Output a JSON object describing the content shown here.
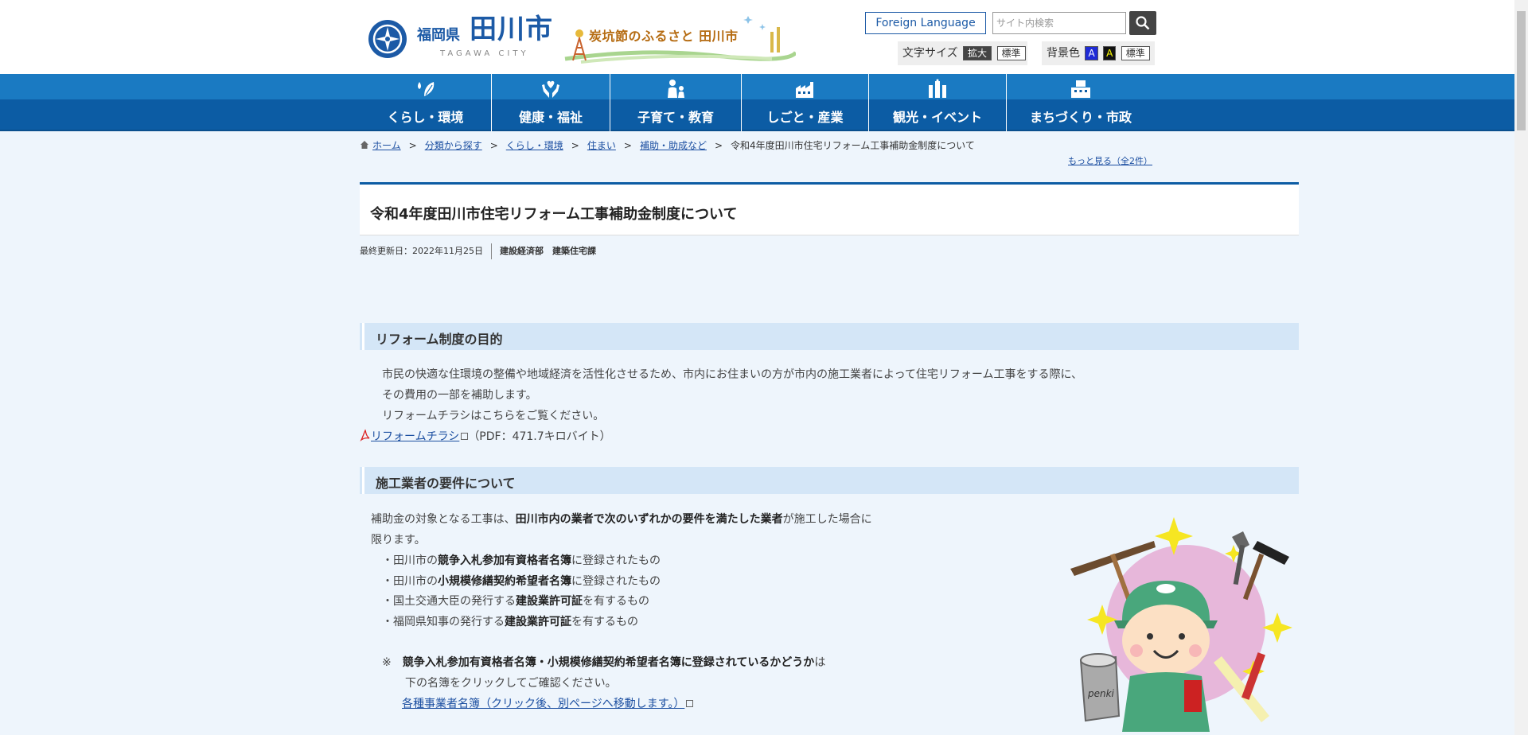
{
  "header": {
    "pref_name": "福岡県",
    "city_name": "田川市",
    "city_roman": "TAGAWA CITY",
    "slogan": "炭坑節のふるさと 田川市",
    "foreign_language": "Foreign Language",
    "search_placeholder": "サイト内検索",
    "font_size_label": "文字サイズ",
    "font_size_enlarge": "拡大",
    "font_size_standard": "標準",
    "bg_color_label": "背景色",
    "bg_blue": "A",
    "bg_black": "A",
    "bg_standard": "標準"
  },
  "nav": {
    "items": [
      {
        "label": "くらし・環境",
        "icon": "leaf-drop-icon"
      },
      {
        "label": "健康・福祉",
        "icon": "hands-heart-icon"
      },
      {
        "label": "子育て・教育",
        "icon": "parent-child-icon"
      },
      {
        "label": "しごと・産業",
        "icon": "factory-icon"
      },
      {
        "label": "観光・イベント",
        "icon": "tourism-icon"
      },
      {
        "label": "まちづくり・市政",
        "icon": "building-icon"
      }
    ]
  },
  "breadcrumb": {
    "items": [
      "ホーム",
      "分類から探す",
      "くらし・環境",
      "住まい",
      "補助・助成など"
    ],
    "current": "令和4年度田川市住宅リフォーム工事補助金制度について",
    "separator": ">",
    "more_link": "もっと見る（全2件）"
  },
  "page": {
    "title": "令和4年度田川市住宅リフォーム工事補助金制度について",
    "updated": "最終更新日：2022年11月25日",
    "department": "建設経済部　建築住宅課"
  },
  "section1": {
    "heading": "リフォーム制度の目的",
    "line1": "市民の快適な住環境の整備や地域経済を活性化させるため、市内にお住まいの方が市内の施工業者によって住宅リフォーム工事をする際に、",
    "line2": "その費用の一部を補助します。",
    "line3": "リフォームチラシはこちらをご覧ください。",
    "pdf_link": "リフォームチラシ",
    "pdf_info": "（PDF：471.7キロバイト）"
  },
  "section2": {
    "heading": "施工業者の要件について",
    "intro_a": "補助金の対象となる工事は、",
    "intro_b": "田川市内の業者で次のいずれかの要件を満たした業者",
    "intro_c": "が施工した場合に",
    "intro_d": "限ります。",
    "bullets": [
      {
        "pre": "・田川市の",
        "bold": "競争入札参加有資格者名簿",
        "post": "に登録されたもの"
      },
      {
        "pre": "・田川市の",
        "bold": "小規模修繕契約希望者名簿",
        "post": "に登録されたもの"
      },
      {
        "pre": "・国土交通大臣の発行する",
        "bold": "建設業許可証",
        "post": "を有するもの"
      },
      {
        "pre": "・福岡県知事の発行する",
        "bold": "建設業許可証",
        "post": "を有するもの"
      }
    ],
    "note_mark": "※",
    "note_bold": "競争入札参加有資格者名簿・小規模修繕契約希望者名簿に登録されているかどうか",
    "note_post": "は",
    "note_line2": "下の名簿をクリックしてご確認ください。",
    "list_link": "各種事業者名簿（クリック後、別ページへ移動します。）",
    "illustration_text": "penki"
  },
  "colors": {
    "brand_blue": "#1c5aa6",
    "nav_top": "#1a7ac2",
    "nav_bottom": "#0c5ca4",
    "section_bg": "#d4e6f7",
    "page_bg": "#eef5fc",
    "link": "#1c4fa1"
  }
}
